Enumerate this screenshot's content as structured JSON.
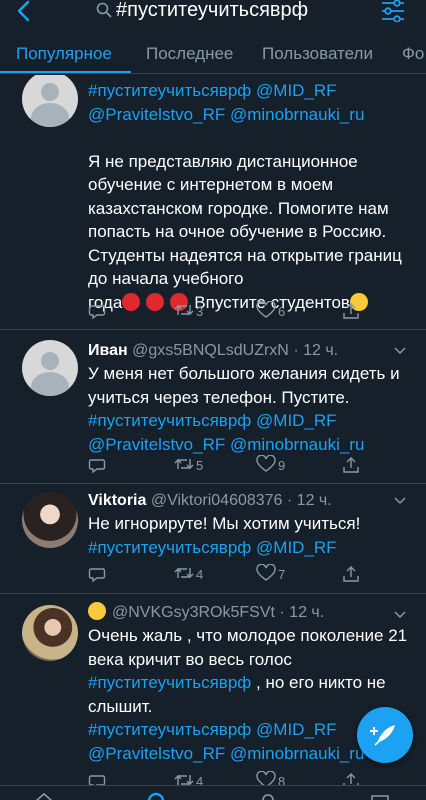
{
  "search": {
    "query": "#пуститеучитьсяврф"
  },
  "tabs": [
    {
      "label": "Популярное",
      "active": true
    },
    {
      "label": "Последнее"
    },
    {
      "label": "Пользователи"
    },
    {
      "label": "Фо"
    }
  ],
  "colors": {
    "background": "#15202b",
    "accent": "#1da1f2",
    "secondary_text": "#8899a6",
    "divider": "#38444d"
  },
  "tweets": [
    {
      "lines": [
        "#пуститеучитьсяврф @MID_RF",
        "@Pravitelstvo_RF @minobrnauki_ru",
        "",
        "Я не представляю дистанционное",
        "обучение с интернетом в моем",
        "казахстанском городке. Помогите нам",
        "попасть на очное обучение в Россию.",
        "Студенты надеятся на открытие границ",
        "до начала учебного"
      ],
      "last_line_start": "года",
      "last_line_end": "Впустите студентов",
      "hashtag": "#пуститеучитьсяврф",
      "mention1": "@MID_RF",
      "mention2": "@Pravitelstvo_RF",
      "mention3": "@minobrnauki_ru",
      "retweets": "3",
      "likes": "6",
      "avatar": "default-avatar"
    },
    {
      "name": "Иван",
      "handle": "@gxs5BNQLsdUZrxN",
      "time": "· 12 ч.",
      "line1": "У меня нет большого желания сидеть и",
      "line2": "учиться через телефон. Пустите.",
      "hashtag": "#пуститеучитьсяврф",
      "mention1": "@MID_RF",
      "mention2": "@Pravitelstvo_RF",
      "mention3": "@minobrnauki_ru",
      "retweets": "5",
      "likes": "9",
      "avatar": "default-avatar"
    },
    {
      "name": "Viktoria",
      "handle": "@Viktori04608376",
      "time": "· 12 ч.",
      "line1": "Не игнорируте! Мы хотим учиться!",
      "hashtag": "#пуститеучитьсяврф",
      "mention1": "@MID_RF",
      "retweets": "4",
      "likes": "7",
      "avatar": "photo-avatar"
    },
    {
      "handle": "@NVKGsy3ROk5FSVt",
      "time": "· 12 ч.",
      "line1": "Очень жаль , что молодое поколение 21",
      "line2": "века кричит во весь голос",
      "hashtag": "#пуститеучитьсяврф",
      "line3_tail": " , но его никто не",
      "line4": "слышит.",
      "mention1": "@MID_RF",
      "mention2": "@Pravitelstvo_RF",
      "mention3": "@minobrnauki_ru",
      "retweets": "4",
      "likes": "8",
      "avatar": "photo-avatar"
    }
  ]
}
